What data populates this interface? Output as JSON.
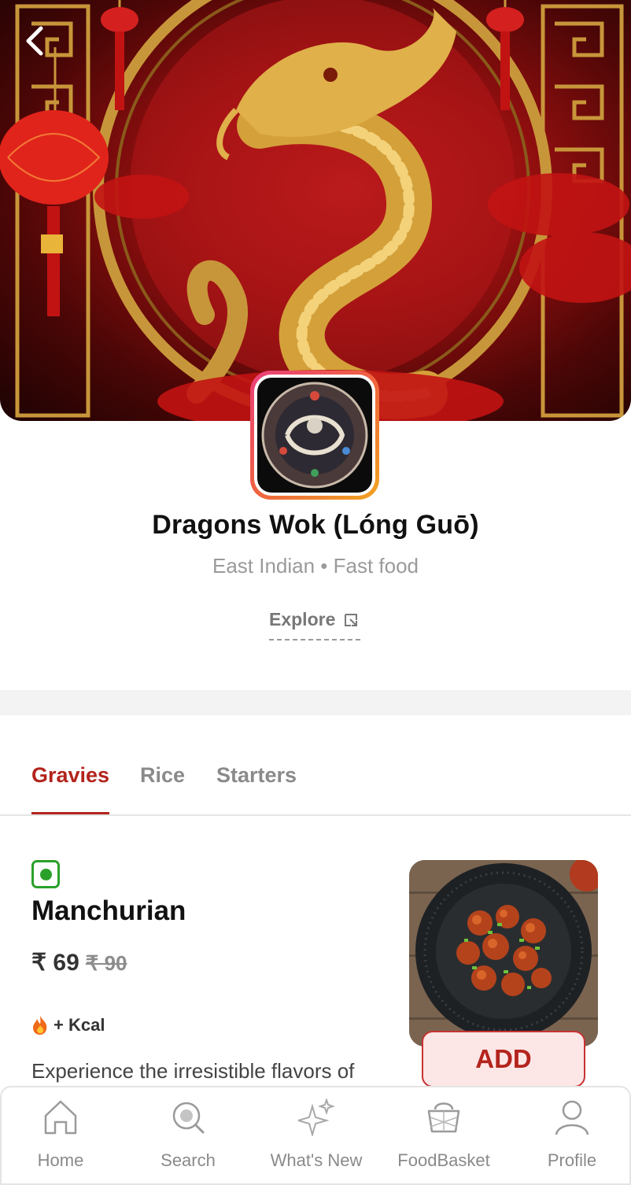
{
  "header": {
    "back_label": ""
  },
  "restaurant": {
    "name": "Dragons Wok (Lóng Guō)",
    "cuisine": "East Indian • Fast food",
    "explore_label": "Explore"
  },
  "tabs": [
    {
      "label": "Gravies",
      "active": true
    },
    {
      "label": "Rice",
      "active": false
    },
    {
      "label": "Starters",
      "active": false
    }
  ],
  "item": {
    "name": "Manchurian",
    "price": "₹ 69",
    "price_original": "₹ 90",
    "kcal_label": "+ Kcal",
    "description": "Experience the irresistible flavors of",
    "add_label": "ADD",
    "veg": true
  },
  "bottom_nav": [
    {
      "label": "Home",
      "icon": "home-icon"
    },
    {
      "label": "Search",
      "icon": "search-icon"
    },
    {
      "label": "What's New",
      "icon": "sparkle-icon"
    },
    {
      "label": "FoodBasket",
      "icon": "basket-icon"
    },
    {
      "label": "Profile",
      "icon": "profile-icon"
    }
  ],
  "colors": {
    "accent": "#b3241d",
    "veg_green": "#2aa12a",
    "add_bg": "#fde6e6",
    "muted_text": "#8a8a8a"
  }
}
